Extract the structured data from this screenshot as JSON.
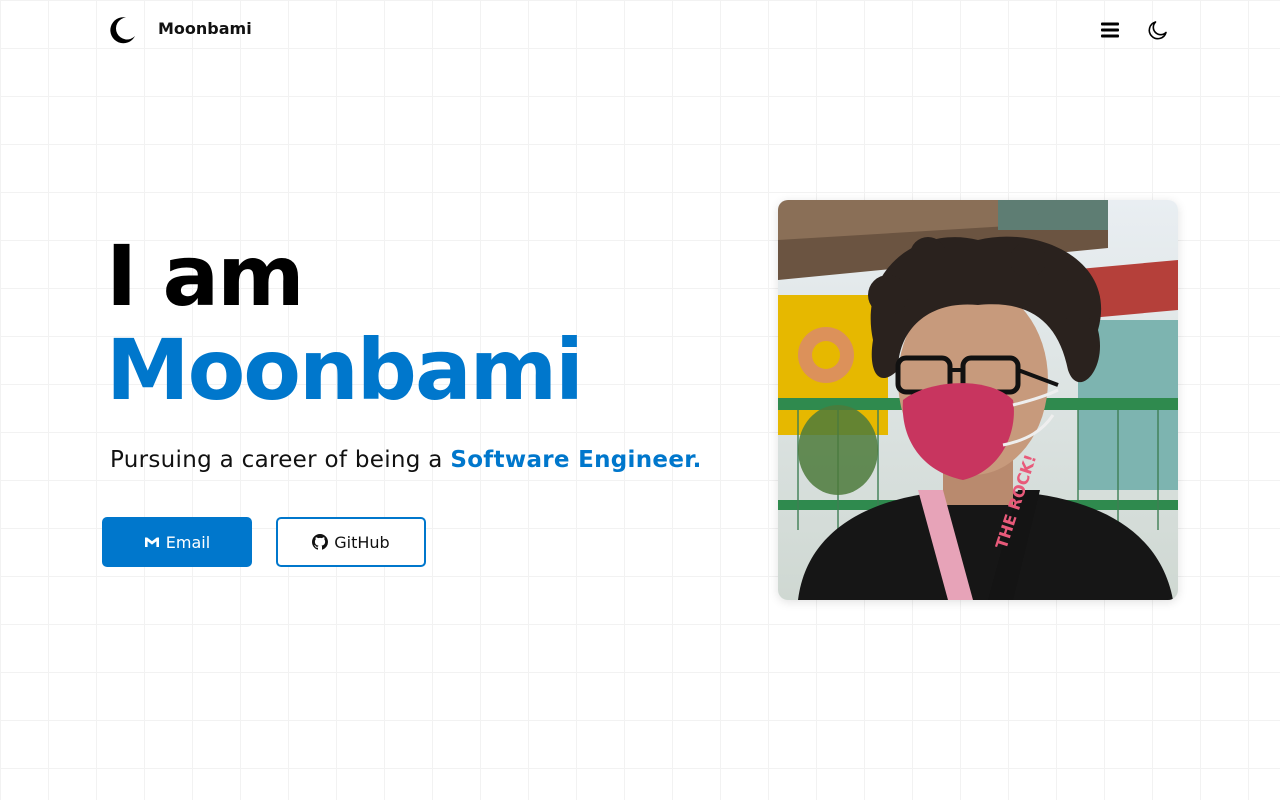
{
  "colors": {
    "accent": "#0077cc",
    "text": "#111111",
    "background": "#ffffff"
  },
  "nav": {
    "brand": "Moonbami",
    "logo_icon": "crescent-moon-icon",
    "menu_icon": "hamburger-menu-icon",
    "theme_icon": "moon-theme-toggle-icon"
  },
  "hero": {
    "line1": "I am",
    "line2": "Moonbami",
    "tagline_prefix": "Pursuing a career of being a ",
    "tagline_highlight": "Software Engineer."
  },
  "buttons": {
    "email": {
      "label": "Email",
      "icon": "gmail-icon"
    },
    "github": {
      "label": "GitHub",
      "icon": "github-icon"
    }
  },
  "photo": {
    "subject": "portrait-photo",
    "lanyard_text": "THE ROCK!"
  }
}
